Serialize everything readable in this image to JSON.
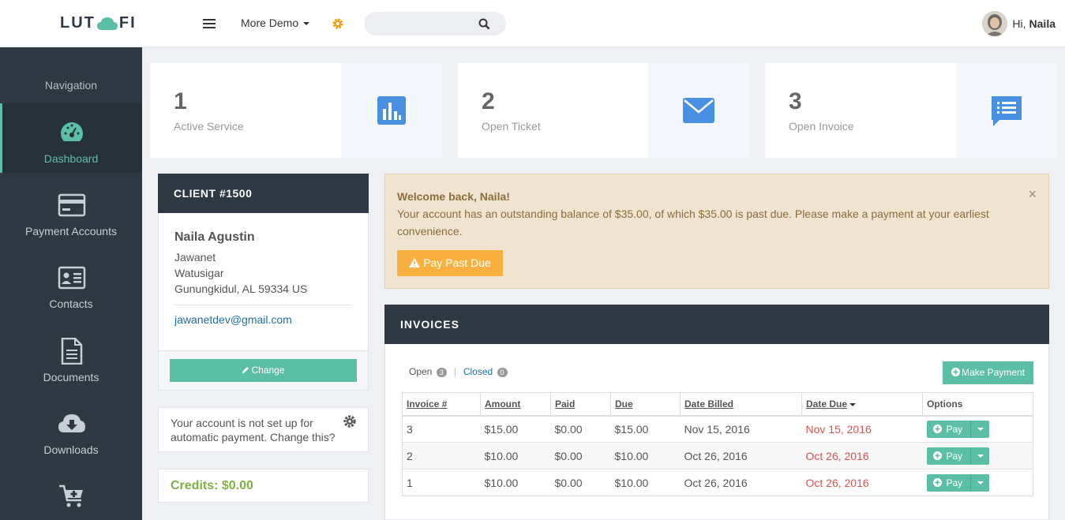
{
  "header": {
    "logo_left": "LUT",
    "logo_right": "FI",
    "more_demo": "More Demo",
    "search_placeholder": "",
    "greeting": "Hi,",
    "user_name": "Naila"
  },
  "sidebar": {
    "title": "Navigation",
    "items": [
      {
        "label": "Dashboard",
        "icon": "dashboard-icon"
      },
      {
        "label": "Payment Accounts",
        "icon": "credit-card-icon"
      },
      {
        "label": "Contacts",
        "icon": "contact-card-icon"
      },
      {
        "label": "Documents",
        "icon": "document-icon"
      },
      {
        "label": "Downloads",
        "icon": "cloud-download-icon"
      },
      {
        "label": "",
        "icon": "cart-plus-icon"
      }
    ]
  },
  "stats": [
    {
      "value": "1",
      "label": "Active Service",
      "icon": "bar-chart-icon"
    },
    {
      "value": "2",
      "label": "Open Ticket",
      "icon": "envelope-icon"
    },
    {
      "value": "3",
      "label": "Open Invoice",
      "icon": "list-chat-icon"
    }
  ],
  "client": {
    "header": "CLIENT #1500",
    "name": "Naila Agustin",
    "company": "Jawanet",
    "street": "Watusigar",
    "city": "Gunungkidul, AL 59334 US",
    "email": "jawanetdev@gmail.com",
    "change_label": "Change"
  },
  "autopay": {
    "text": "Your account is not set up for automatic payment. Change this?"
  },
  "credits": {
    "text": "Credits: $0.00"
  },
  "alert": {
    "welcome": "Welcome back, Naila!",
    "message": "Your account has an outstanding balance of $35.00, of which $35.00 is past due. Please make a payment at your earliest convenience.",
    "button": "Pay Past Due",
    "close": "×"
  },
  "invoices": {
    "header": "INVOICES",
    "tab_open": "Open",
    "tab_open_count": "3",
    "tab_sep": "|",
    "tab_closed": "Closed",
    "tab_closed_count": "0",
    "make_payment": "Make Payment",
    "columns": [
      "Invoice #",
      "Amount",
      "Paid",
      "Due",
      "Date Billed",
      "Date Due",
      "Options"
    ],
    "rows": [
      {
        "invoice": "3",
        "amount": "$15.00",
        "paid": "$0.00",
        "due": "$15.00",
        "billed": "Nov 15, 2016",
        "date_due": "Nov 15, 2016",
        "option": "Pay"
      },
      {
        "invoice": "2",
        "amount": "$10.00",
        "paid": "$0.00",
        "due": "$10.00",
        "billed": "Oct 26, 2016",
        "date_due": "Oct 26, 2016",
        "option": "Pay"
      },
      {
        "invoice": "1",
        "amount": "$10.00",
        "paid": "$0.00",
        "due": "$10.00",
        "billed": "Oct 26, 2016",
        "date_due": "Oct 26, 2016",
        "option": "Pay"
      }
    ]
  },
  "colors": {
    "accent": "#5bbfa6",
    "dark": "#2f3943",
    "warning": "#f8b13f",
    "danger": "#d9534f",
    "icon_blue": "#4a90e2"
  }
}
